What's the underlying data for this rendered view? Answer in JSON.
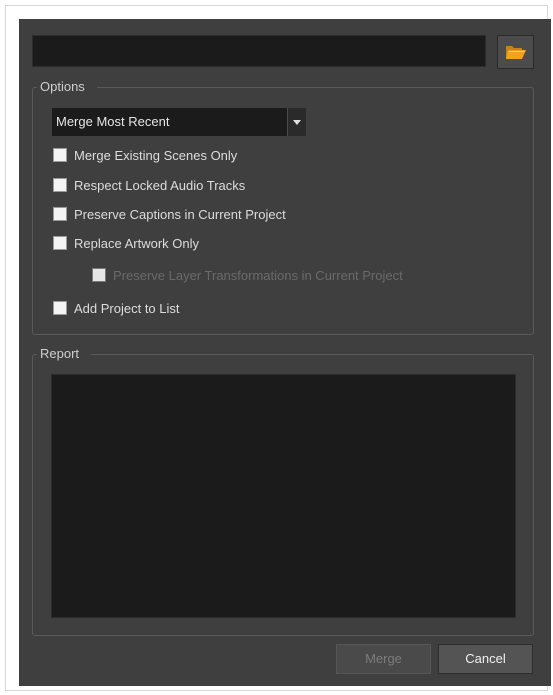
{
  "path_field": {
    "value": ""
  },
  "browse": {
    "icon": "folder-open-icon",
    "color": "#f2a31b"
  },
  "options": {
    "title": "Options",
    "merge_mode": {
      "selected": "Merge Most Recent"
    },
    "checkboxes": [
      {
        "label": "Merge Existing Scenes Only",
        "checked": false,
        "enabled": true
      },
      {
        "label": "Respect Locked Audio Tracks",
        "checked": false,
        "enabled": true
      },
      {
        "label": "Preserve Captions in Current Project",
        "checked": false,
        "enabled": true
      },
      {
        "label": "Replace Artwork Only",
        "checked": false,
        "enabled": true
      },
      {
        "label": "Preserve Layer Transformations in Current Project",
        "checked": false,
        "enabled": false
      },
      {
        "label": "Add Project to List",
        "checked": false,
        "enabled": true
      }
    ]
  },
  "report": {
    "title": "Report",
    "content": ""
  },
  "buttons": {
    "merge": "Merge",
    "cancel": "Cancel"
  }
}
